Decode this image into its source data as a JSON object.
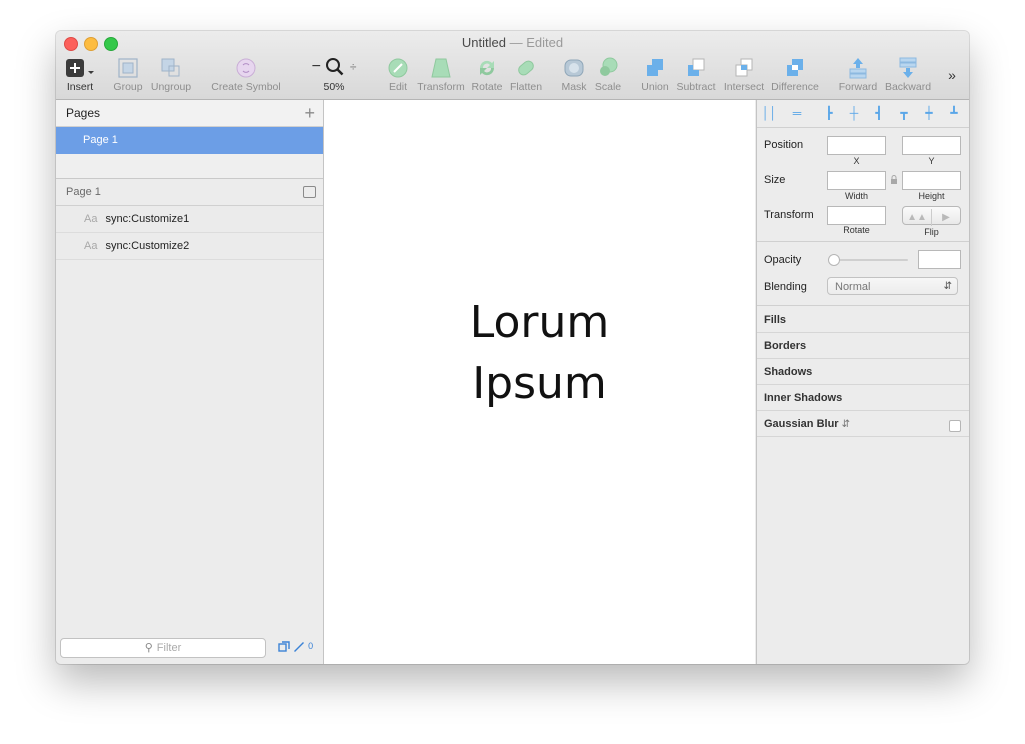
{
  "window": {
    "title": "Untitled",
    "title_separator": "—",
    "title_status": "Edited"
  },
  "toolbar": {
    "insert": "Insert",
    "group": "Group",
    "ungroup": "Ungroup",
    "create_symbol": "Create Symbol",
    "zoom_minus": "−",
    "zoom_plus": "÷",
    "zoom_level": "50%",
    "edit": "Edit",
    "transform": "Transform",
    "rotate": "Rotate",
    "flatten": "Flatten",
    "mask": "Mask",
    "scale": "Scale",
    "union": "Union",
    "subtract": "Subtract",
    "intersect": "Intersect",
    "difference": "Difference",
    "forward": "Forward",
    "backward": "Backward",
    "more": "»"
  },
  "sidebar": {
    "pages_title": "Pages",
    "add_page": "+",
    "pages": [
      "Page 1"
    ],
    "current_page_header": "Page 1",
    "layers": [
      {
        "icon": "Aa",
        "name": "sync:Customize1"
      },
      {
        "icon": "Aa",
        "name": "sync:Customize2"
      }
    ],
    "filter_placeholder": "Filter",
    "filter_count": "0"
  },
  "canvas": {
    "line1": "Lorum",
    "line2": "Ipsum"
  },
  "inspector": {
    "position_label": "Position",
    "x_caption": "X",
    "y_caption": "Y",
    "size_label": "Size",
    "width_caption": "Width",
    "height_caption": "Height",
    "transform_label": "Transform",
    "rotate_caption": "Rotate",
    "flip_caption": "Flip",
    "opacity_label": "Opacity",
    "blending_label": "Blending",
    "blending_value": "Normal",
    "sections": {
      "fills": "Fills",
      "borders": "Borders",
      "shadows": "Shadows",
      "inner_shadows": "Inner Shadows",
      "gaussian_blur": "Gaussian Blur"
    }
  },
  "colors": {
    "selected_page": "#6c9ee6",
    "accent_blue": "#5aa6e8",
    "boolean_icon_blue": "#4a9fe0",
    "vector_icon_green": "#8fd6a4"
  }
}
